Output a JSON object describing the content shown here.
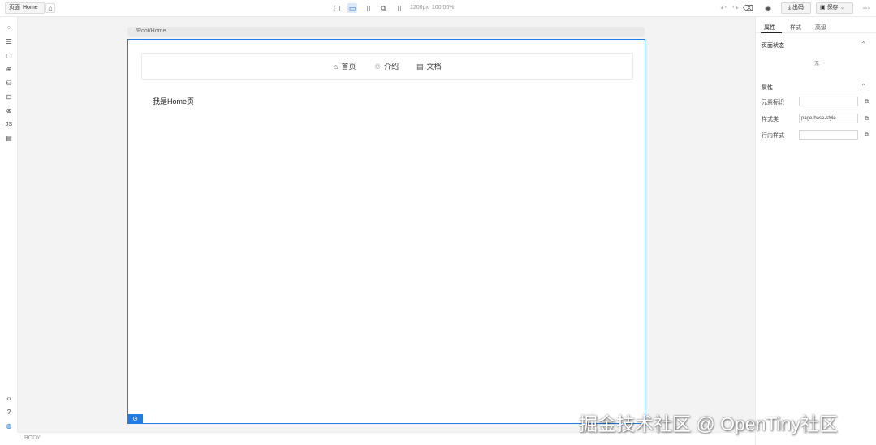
{
  "topbar": {
    "page_label": "页面",
    "page_name": "Home",
    "canvas_size": "1200px",
    "zoom": "100.00%",
    "publish_label": "出码",
    "save_label": "保存"
  },
  "icons": {
    "left_tools": [
      "layers-icon",
      "outline-icon",
      "page-icon",
      "blocks-icon",
      "data-source-icon",
      "bridge-icon",
      "i18n-icon",
      "js-icon",
      "schema-icon"
    ],
    "left_bottom": [
      "code-icon",
      "help-icon",
      "tutorial-icon"
    ]
  },
  "left_toolbar": {
    "js_label": "JS"
  },
  "canvas": {
    "breadcrumb": "/Root/Home",
    "nav": [
      {
        "icon": "⌂",
        "label": "首页"
      },
      {
        "icon": "♲",
        "label": "介绍"
      },
      {
        "icon": "▤",
        "label": "文档"
      }
    ],
    "page_text": "我是Home页",
    "selection_icon": "⊙",
    "accent_color": "#1f7be8"
  },
  "statusbar": {
    "text": "BODY"
  },
  "right_panel": {
    "tabs": [
      "属性",
      "样式",
      "高级"
    ],
    "active_tab": "属性",
    "section_status": "页面状态",
    "status_value": "无",
    "section_props": "属性",
    "props": [
      {
        "label": "元素标识",
        "value": ""
      },
      {
        "label": "样式类",
        "value": "page-base-style"
      },
      {
        "label": "行内样式",
        "value": ""
      }
    ]
  },
  "watermark": "掘金技术社区 @ OpenTiny社区"
}
